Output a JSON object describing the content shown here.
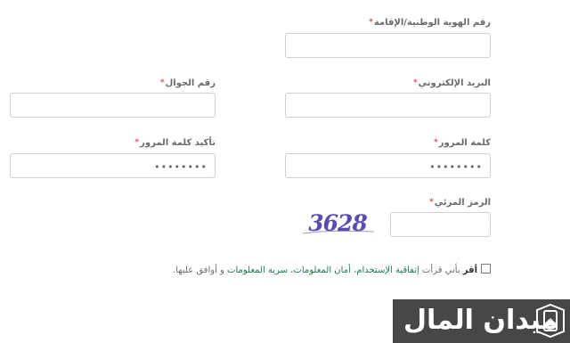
{
  "form": {
    "required_mark": "*",
    "id_number": {
      "label": "رقم الهوية الوطنية/الإقامة",
      "value": ""
    },
    "email": {
      "label": "البريد الإلكتروني",
      "value": ""
    },
    "mobile": {
      "label": "رقم الجوال",
      "value": ""
    },
    "password": {
      "label": "كلمة المرور",
      "value": "••••••••"
    },
    "confirm_password": {
      "label": "تأكيد كلمة المرور",
      "value": "••••••••"
    },
    "captcha": {
      "label": "الرمز المرئي",
      "image_text": "3628",
      "value": ""
    }
  },
  "agreement": {
    "checked": false,
    "bold": "أقر",
    "text1": " بأني قرأت ",
    "link_terms": "إتفاقية الإستخدام",
    "sep1": "، ",
    "link_security": "أمان المعلومات",
    "sep2": "، ",
    "link_privacy": "سرية المعلومات",
    "text2": " و أوافق عليها."
  },
  "logo": {
    "text": "ميدان المال",
    "icon": "phone-dollar-icon"
  },
  "colors": {
    "link": "#1e7a4d",
    "required": "#d9534f",
    "captcha": "#5b4bb0",
    "logo_bg": "#474747"
  }
}
